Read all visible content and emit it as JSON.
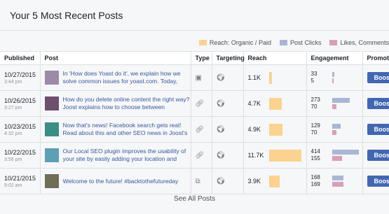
{
  "card": {
    "title": "Your 5 Most Recent Posts"
  },
  "legend": [
    {
      "label": "Reach: Organic / Paid",
      "color": "#fbd28e"
    },
    {
      "label": "Post Clicks",
      "color": "#aab6d3"
    },
    {
      "label": "Likes, Comments",
      "color": "#d8a0b8"
    }
  ],
  "columns": {
    "published": "Published",
    "post": "Post",
    "type": "Type",
    "targeting": "Targeting",
    "reach": "Reach",
    "engagement": "Engagement",
    "promote": "Promote"
  },
  "rows": [
    {
      "date": "10/27/2015",
      "time": "3:44 pm",
      "text": "In 'How does Yoast do it', we explain how we solve common issues for yoast.com. Today, Joost lets you",
      "type_icon": "video-icon",
      "reach": "1.1K",
      "reach_fraction": 0.09,
      "clicks": "33",
      "likes": "5",
      "clicks_fraction": 0.08,
      "likes_fraction": 0.0,
      "boost": "Boost Post"
    },
    {
      "date": "10/26/2015",
      "time": "3:27 pm",
      "text": "How do you delete online content the right way? Joost explains how to choose between redirecting or",
      "type_icon": "link-icon",
      "reach": "4.7K",
      "reach_fraction": 0.4,
      "clicks": "273",
      "likes": "70",
      "clicks_fraction": 0.66,
      "likes_fraction": 0.17,
      "boost": "Boost Post"
    },
    {
      "date": "10/23/2015",
      "time": "4:32 pm",
      "text": "Now that's news! Facebook search gets real! Read about this and other SEO news in Joost's weekly SEO",
      "type_icon": "link-icon",
      "reach": "4.9K",
      "reach_fraction": 0.42,
      "clicks": "129",
      "likes": "70",
      "clicks_fraction": 0.31,
      "likes_fraction": 0.17,
      "boost": "Boost Post"
    },
    {
      "date": "10/22/2015",
      "time": "3:56 pm",
      "text": "Our Local SEO plugin improves the usability of your site by easily adding your location and opening hours",
      "type_icon": "link-icon",
      "reach": "11.7K",
      "reach_fraction": 1.0,
      "clicks": "414",
      "likes": "155",
      "clicks_fraction": 1.0,
      "likes_fraction": 0.37,
      "boost": "Boost Post"
    },
    {
      "date": "10/21/2015",
      "time": "9:02 am",
      "text": "Welcome to the future! #backtothefutureday",
      "type_icon": "photo-icon",
      "reach": "3.9K",
      "reach_fraction": 0.33,
      "clicks": "168",
      "likes": "169",
      "clicks_fraction": 0.41,
      "likes_fraction": 0.41,
      "boost": "Boost Post"
    }
  ],
  "footer": {
    "see_all": "See All Posts"
  }
}
